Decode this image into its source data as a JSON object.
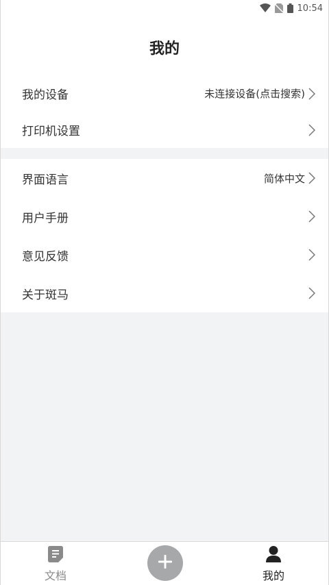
{
  "status_bar": {
    "time": "10:54"
  },
  "header": {
    "title": "我的"
  },
  "settings": {
    "group1": [
      {
        "label": "我的设备",
        "value": "未连接设备(点击搜索)"
      },
      {
        "label": "打印机设置",
        "value": ""
      }
    ],
    "group2": [
      {
        "label": "界面语言",
        "value": "简体中文"
      },
      {
        "label": "用户手册",
        "value": ""
      },
      {
        "label": "意见反馈",
        "value": ""
      },
      {
        "label": "关于斑马",
        "value": ""
      }
    ]
  },
  "tabbar": {
    "docs_label": "文档",
    "mine_label": "我的"
  },
  "colors": {
    "page_bg": "#f2f3f5",
    "card_bg": "#ffffff",
    "add_button": "#a6a8aa",
    "inactive_tab": "#8a8a8a",
    "active_tab": "#222222"
  },
  "icons": {
    "wifi": "wifi-icon",
    "no_sim": "no-sim-icon",
    "battery": "battery-icon",
    "chevron": "chevron-right-icon",
    "document": "document-icon",
    "add": "plus-icon",
    "profile": "person-icon"
  }
}
